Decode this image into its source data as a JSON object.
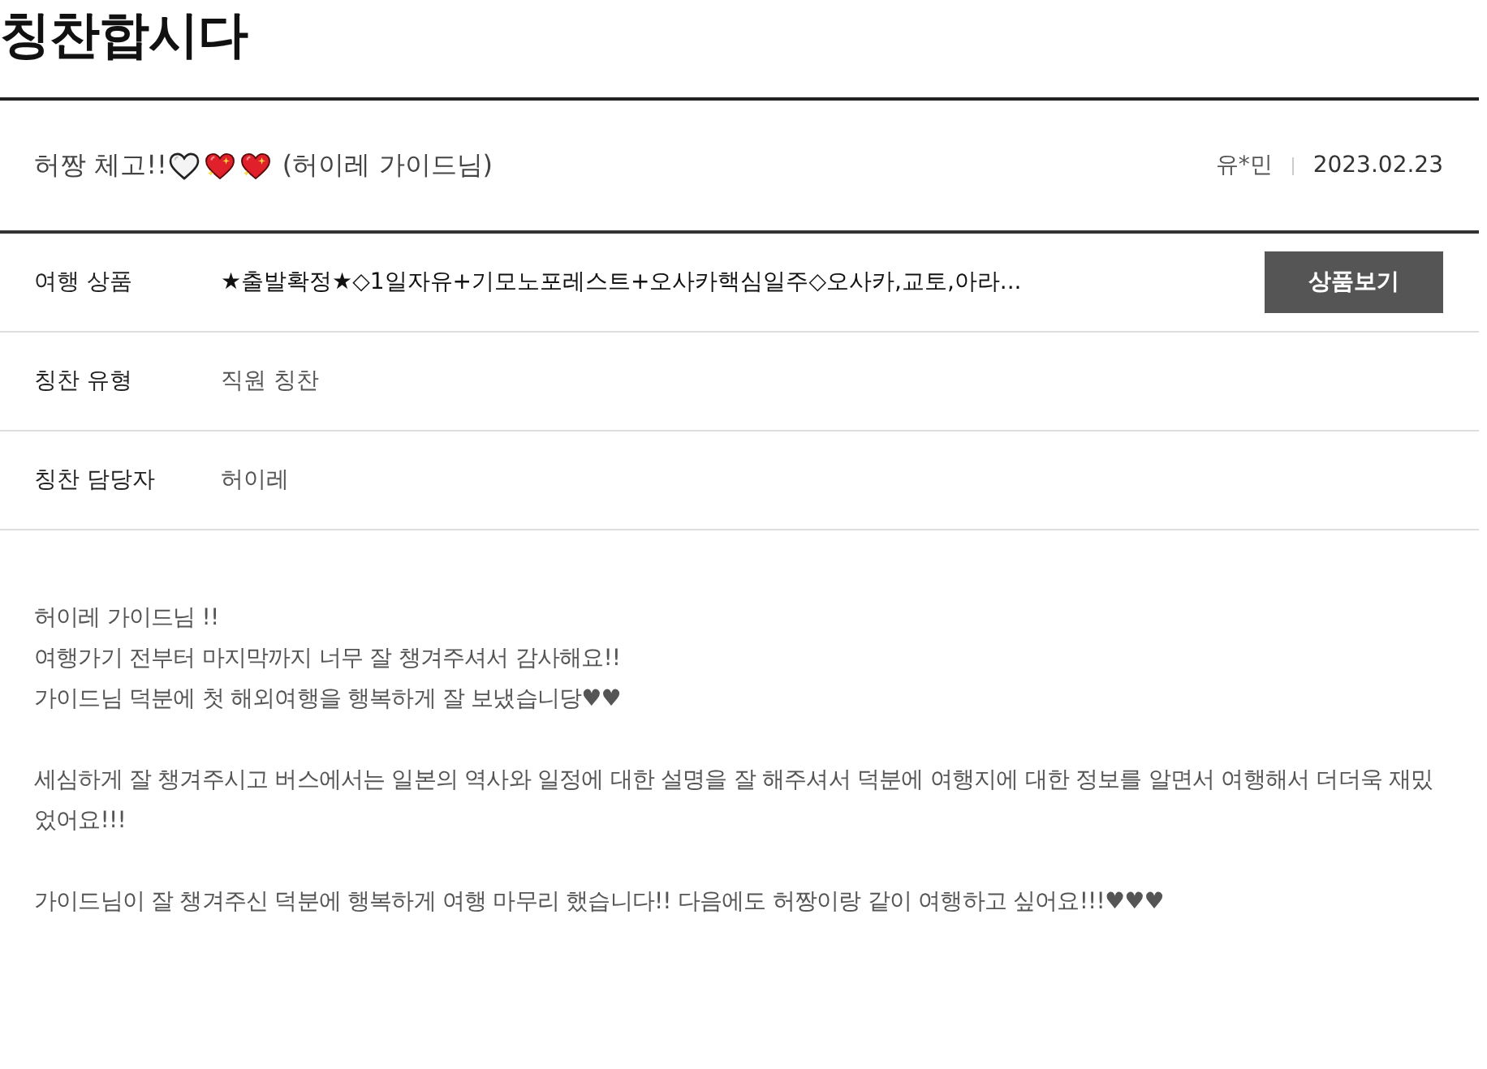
{
  "page_title": "칭찬합시다",
  "review": {
    "title": "허짱 체고!!",
    "title_icons": [
      {
        "kind": "white_heart"
      },
      {
        "kind": "sparkling_heart"
      },
      {
        "kind": "sparkling_heart"
      }
    ],
    "title_suffix": "(허이레 가이드님)",
    "author": "유*민",
    "date": "2023.02.23"
  },
  "details": [
    {
      "kind": "product",
      "label": "여행 상품",
      "value": "★출발확정★◇1일자유+기모노포레스트+오사카핵심일주◇오사카,교토,아라...",
      "button": "상품보기"
    },
    {
      "kind": "plain",
      "label": "칭찬 유형",
      "value": "직원 칭찬"
    },
    {
      "kind": "plain",
      "label": "칭찬 담당자",
      "value": "허이레"
    }
  ],
  "body": {
    "paragraphs": [
      [
        "허이레 가이드님 !!",
        "여행가기 전부터 마지막까지 너무 잘 챙겨주셔서 감사해요!!",
        "가이드님 덕분에 첫 해외여행을 행복하게 잘 보냈습니당♥♥"
      ],
      [
        "세심하게 잘 챙겨주시고 버스에서는 일본의 역사와 일정에 대한 설명을 잘 해주셔서 덕분에 여행지에 대한 정보를 알면서 여행해서 더더욱 재밌었어요!!!"
      ],
      [
        "가이드님이 잘 챙겨주신 덕분에 행복하게 여행 마무리 했습니다!! 다음에도 허짱이랑 같이 여행하고 싶어요!!!♥♥♥"
      ]
    ]
  }
}
